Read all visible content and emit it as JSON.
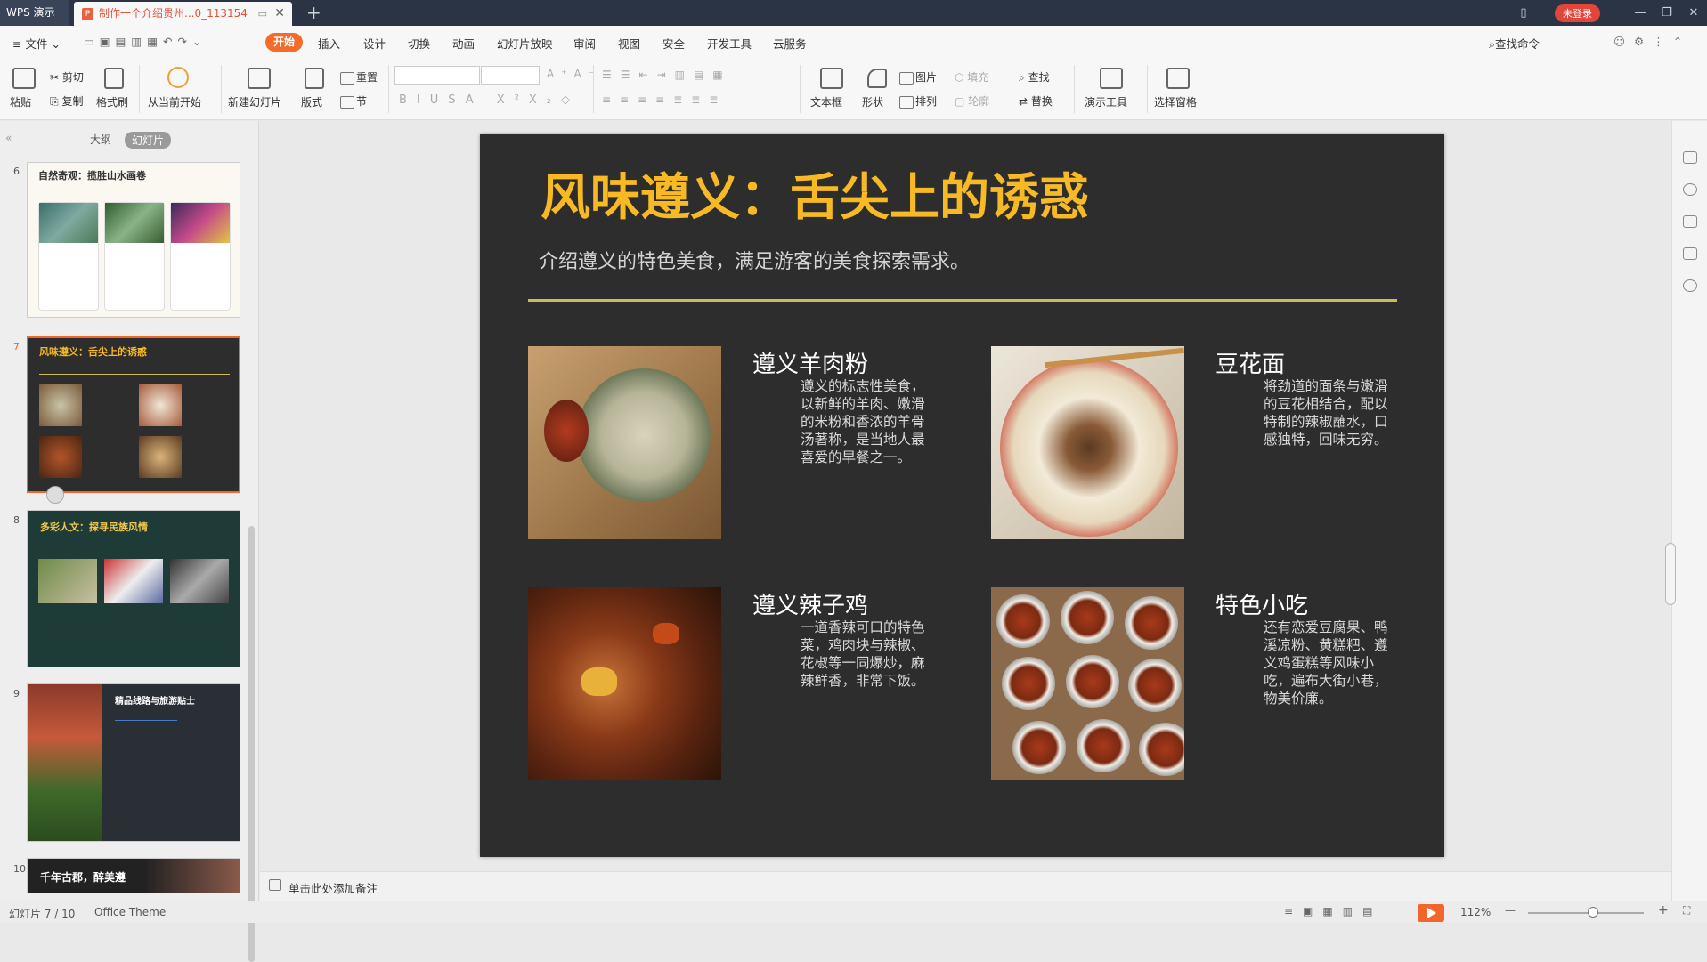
{
  "titlebar": {
    "app_name": "WPS 演示",
    "doc_tab": "制作一个介绍贵州...0_113154",
    "login": "未登录"
  },
  "menu": {
    "file": "文件",
    "start": "开始",
    "items": [
      "插入",
      "设计",
      "切换",
      "动画",
      "幻灯片放映",
      "审阅",
      "视图",
      "安全",
      "开发工具",
      "云服务"
    ],
    "search": "查找命令"
  },
  "toolbar": {
    "paste": "粘贴",
    "cut": "剪切",
    "copy": "复制",
    "format_painter": "格式刷",
    "from_current": "从当前开始",
    "new_slide": "新建幻灯片",
    "layout": "版式",
    "reset": "重置",
    "section": "节",
    "text_box": "文本框",
    "shape": "形状",
    "picture": "图片",
    "arrange": "排列",
    "fill": "填充",
    "outline": "轮廓",
    "find": "查找",
    "replace": "替换",
    "presentation_tools": "演示工具",
    "selection_pane": "选择窗格"
  },
  "left_panel": {
    "tab_outline": "大纲",
    "tab_slides": "幻灯片",
    "slides": [
      {
        "num": "6",
        "title": "自然奇观：揽胜山水画卷"
      },
      {
        "num": "7",
        "title": "风味遵义：舌尖上的诱惑"
      },
      {
        "num": "8",
        "title": "多彩人文：探寻民族风情"
      },
      {
        "num": "9",
        "title": "精品线路与旅游贴士"
      },
      {
        "num": "10",
        "title": "千年古郡，醉美遵"
      }
    ]
  },
  "slide": {
    "title": "风味遵义：舌尖上的诱惑",
    "subtitle": "介绍遵义的特色美食，满足游客的美食探索需求。",
    "foods": [
      {
        "name": "遵义羊肉粉",
        "desc": "遵义的标志性美食，以新鲜的羊肉、嫩滑的米粉和香浓的羊骨汤著称，是当地人最喜爱的早餐之一。"
      },
      {
        "name": "豆花面",
        "desc": "将劲道的面条与嫩滑的豆花相结合，配以特制的辣椒蘸水，口感独特，回味无穷。"
      },
      {
        "name": "遵义辣子鸡",
        "desc": "一道香辣可口的特色菜，鸡肉块与辣椒、花椒等一同爆炒，麻辣鲜香，非常下饭。"
      },
      {
        "name": "特色小吃",
        "desc": "还有恋爱豆腐果、鸭溪凉粉、黄糕粑、遵义鸡蛋糕等风味小吃，遍布大街小巷，物美价廉。"
      }
    ]
  },
  "notes": {
    "placeholder": "单击此处添加备注"
  },
  "status": {
    "slide_count": "幻灯片 7 / 10",
    "theme": "Office Theme",
    "zoom": "112%"
  }
}
